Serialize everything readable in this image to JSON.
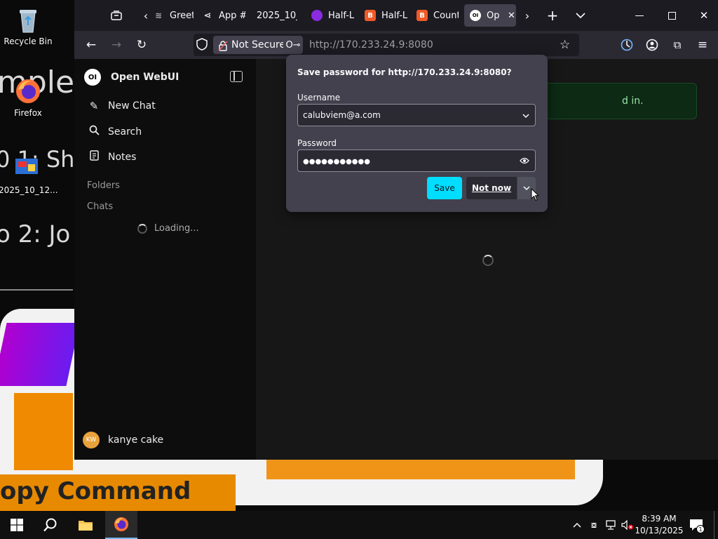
{
  "desktop": {
    "icons": [
      {
        "label": "Recycle Bin"
      },
      {
        "label": "Firefox"
      },
      {
        "label": "2025_10_12..."
      }
    ],
    "wallpaper_text": [
      "mple",
      "0 1: Sh",
      "o 2: Jo",
      "opy Command"
    ]
  },
  "browser": {
    "tabs": [
      {
        "label": "Greeti"
      },
      {
        "label": "App #"
      },
      {
        "label": "2025_10_1"
      },
      {
        "label": "Half-L"
      },
      {
        "label": "Half-L"
      },
      {
        "label": "Count"
      },
      {
        "label": "Op"
      }
    ],
    "tab_favicons": {
      "active": "OI",
      "brave": "B"
    },
    "security_label": "Not Secure",
    "url": "http://170.233.24.9:8080"
  },
  "app": {
    "name": "Open WebUI",
    "logo_text": "OI",
    "nav": [
      {
        "label": "New Chat",
        "icon": "pencil-icon"
      },
      {
        "label": "Search",
        "icon": "search-icon"
      },
      {
        "label": "Notes",
        "icon": "notes-icon"
      }
    ],
    "sections": {
      "folders": "Folders",
      "chats": "Chats"
    },
    "loading_text": "Loading...",
    "user": {
      "initials": "KW",
      "name": "kanye cake"
    },
    "toast_text": "d in."
  },
  "password_prompt": {
    "title": "Save password for http://170.233.24.9:8080?",
    "username_label": "Username",
    "username_value": "calubviem@a.com",
    "password_label": "Password",
    "password_value": "●●●●●●●●●●●",
    "save_label": "Save",
    "not_now_label": "Not now"
  },
  "taskbar": {
    "time": "8:39 AM",
    "date": "10/13/2025",
    "notification_count": "1"
  },
  "colors": {
    "accent": "#00ddff",
    "popup_bg": "#42414d",
    "sidebar_bg": "#0d0d0d",
    "toast_bg": "#0c2a14"
  }
}
